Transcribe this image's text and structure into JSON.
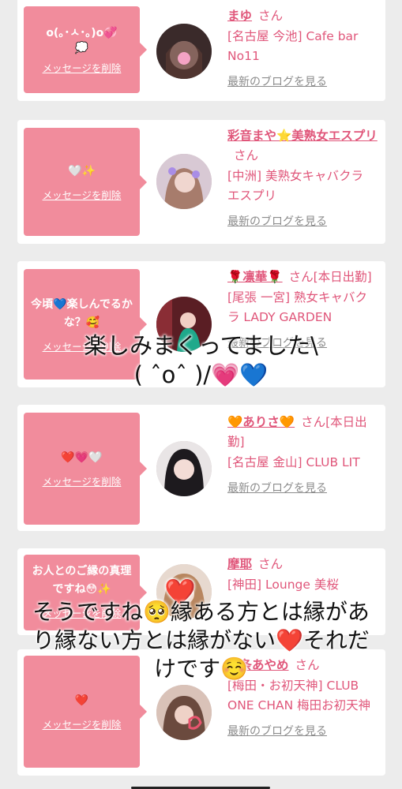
{
  "cards": [
    {
      "bubble_message": "o(｡･ㅅ･｡)o💞",
      "bubble_extra": "💭",
      "delete_label": "メッセージを削除",
      "name": "まゆ",
      "san": "さん",
      "shop": "[名古屋 今池] Cafe bar No11",
      "blog_label": "最新のブログを見る"
    },
    {
      "bubble_message": "🤍✨",
      "bubble_extra": "",
      "delete_label": "メッセージを削除",
      "name": "彩音まや⭐美熟女エスプリ",
      "san": "さん",
      "shop": "[中洲] 美熟女キャバクラ エスプリ",
      "blog_label": "最新のブログを見る"
    },
    {
      "bubble_message": "今頃💙楽しんでるかな？🥰",
      "bubble_extra": "",
      "delete_label": "メッセージを削除",
      "name": "🌹凛華🌹",
      "san": "さん[本日出勤]",
      "shop": "[尾張 一宮] 熟女キャバクラ LADY GARDEN",
      "blog_label": "最新のブログを見る"
    },
    {
      "bubble_message": "❤️💗🤍",
      "bubble_extra": "",
      "delete_label": "メッセージを削除",
      "name": "🧡ありさ🧡",
      "san": "さん[本日出勤]",
      "shop": "[名古屋 金山] CLUB LIT",
      "blog_label": "最新のブログを見る"
    },
    {
      "bubble_message": "お人とのご縁の真理ですね😳✨",
      "bubble_extra": "",
      "delete_label": "メッセージを削除",
      "name": "摩耶",
      "san": "さん",
      "shop": "[神田] Lounge 美桜",
      "blog_label": "最新のブログを見る"
    },
    {
      "bubble_message": "❤️",
      "bubble_extra": "",
      "delete_label": "メッセージを削除",
      "name": "石条あやめ",
      "san": "さん",
      "shop": "[梅田・お初天神] CLUB ONE CHAN 梅田お初天神",
      "blog_label": "最新のブログを見る"
    }
  ],
  "overlay_1": {
    "line1": "楽しみまくってました\\",
    "line2": "( ˆoˆ )/💗💙"
  },
  "overlay_2": {
    "line1": "そうですね🥺縁ある方とは縁があ",
    "line2": "り縁ない方とは縁がない❤️それだ",
    "line3": "けです☺️"
  },
  "overlay_heart": "❤️",
  "colors": {
    "bubble": "#f18c9c",
    "accent_text": "#e0567a",
    "link_gray": "#8c8c8c",
    "background": "#ececec"
  }
}
